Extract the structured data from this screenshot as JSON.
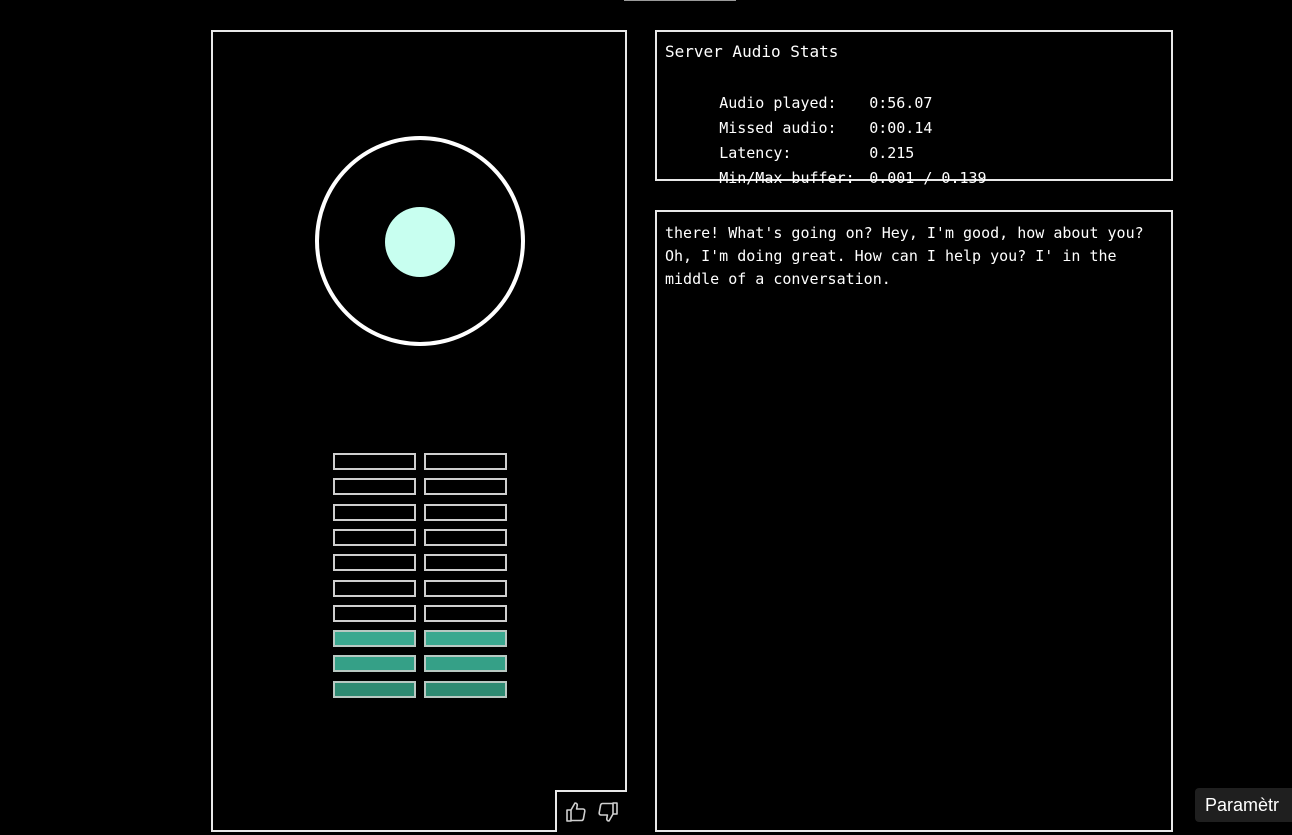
{
  "stats": {
    "title": "Server Audio Stats",
    "rows": [
      {
        "label": "Audio played:",
        "value": "0:56.07"
      },
      {
        "label": "Missed audio:",
        "value": "0:00.14"
      },
      {
        "label": "Latency:",
        "value": "0.215"
      },
      {
        "label": "Min/Max buffer:",
        "value": "0.001 / 0.139"
      }
    ]
  },
  "transcript": {
    "text": "there! What's going on? Hey, I'm good, how about you? Oh, I'm doing great. How can I help you? I' in the middle of a conversation."
  },
  "visualizer": {
    "core_color": "#c8fff0",
    "segments_per_column": 10,
    "active_segments": 3,
    "active_colors": [
      "#3aa88f",
      "#35a087",
      "#2e8a72"
    ]
  },
  "feedback": {
    "like_icon": "thumbs-up-icon",
    "dislike_icon": "thumbs-down-icon"
  },
  "settings_button": {
    "label": "Paramètr"
  }
}
